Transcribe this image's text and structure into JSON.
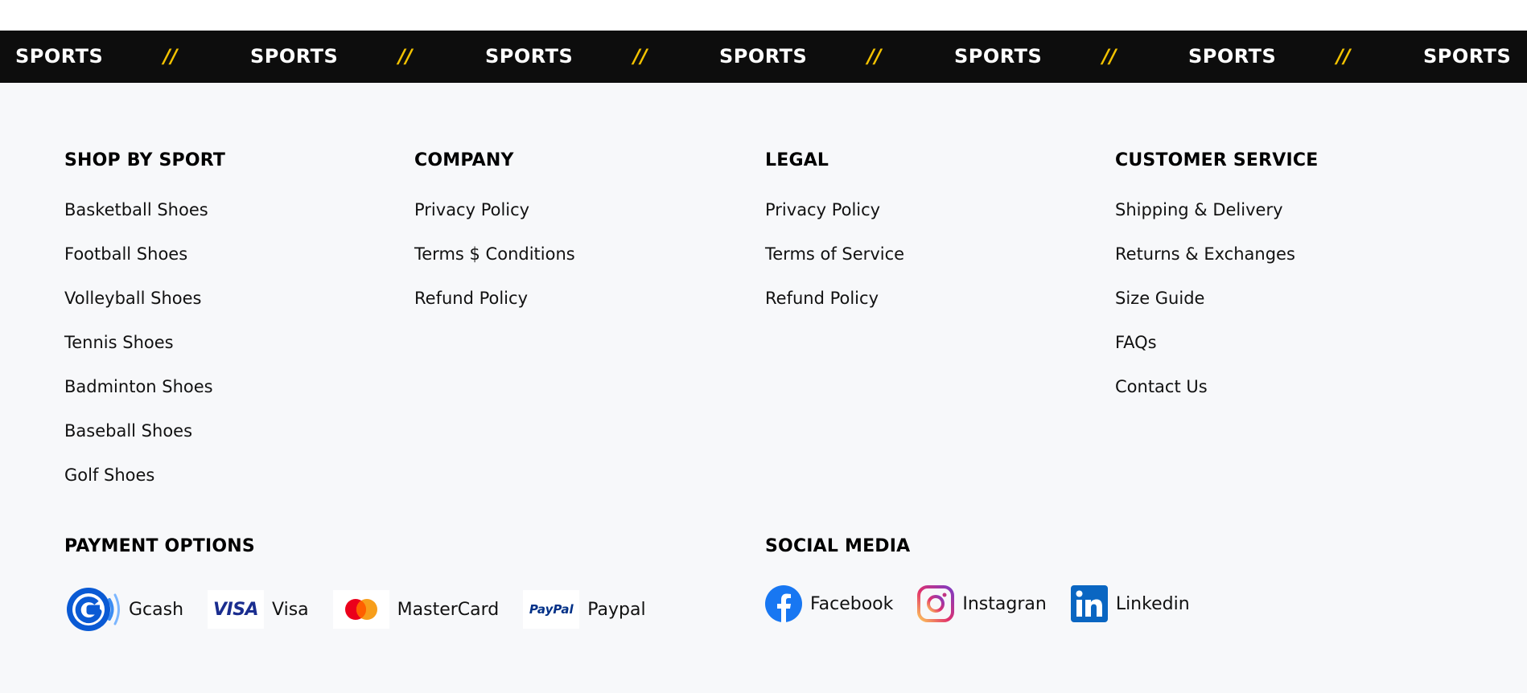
{
  "marquee": {
    "word": "SPORTS",
    "separator": "//",
    "colors": {
      "background": "#0d0d0d",
      "word": "#ffffff",
      "separator": "#f2c200"
    }
  },
  "columns": [
    {
      "title": "SHOP BY SPORT",
      "links": [
        "Basketball Shoes",
        "Football Shoes",
        "Volleyball Shoes",
        "Tennis Shoes",
        "Badminton Shoes",
        "Baseball Shoes",
        "Golf Shoes"
      ]
    },
    {
      "title": "COMPANY",
      "links": [
        "Privacy Policy",
        "Terms $ Conditions",
        "Refund Policy"
      ]
    },
    {
      "title": "LEGAL",
      "links": [
        "Privacy Policy",
        "Terms of Service",
        "Refund Policy"
      ]
    },
    {
      "title": "CUSTOMER SERVICE",
      "links": [
        "Shipping & Delivery",
        "Returns & Exchanges",
        "Size Guide",
        "FAQs",
        "Contact Us"
      ]
    }
  ],
  "payment": {
    "title": "PAYMENT OPTIONS",
    "items": [
      {
        "label": "Gcash",
        "icon": "gcash-icon"
      },
      {
        "label": "Visa",
        "icon": "visa-icon",
        "logo_text": "VISA"
      },
      {
        "label": "MasterCard",
        "icon": "mastercard-icon"
      },
      {
        "label": "Paypal",
        "icon": "paypal-icon",
        "logo_text": "PayPal"
      }
    ]
  },
  "social": {
    "title": "SOCIAL MEDIA",
    "items": [
      {
        "label": "Facebook",
        "icon": "facebook-icon",
        "color": "#1877f2"
      },
      {
        "label": "Instagran",
        "icon": "instagram-icon",
        "color": "#e1306c"
      },
      {
        "label": "Linkedin",
        "icon": "linkedin-icon",
        "color": "#0a66c2"
      }
    ]
  }
}
